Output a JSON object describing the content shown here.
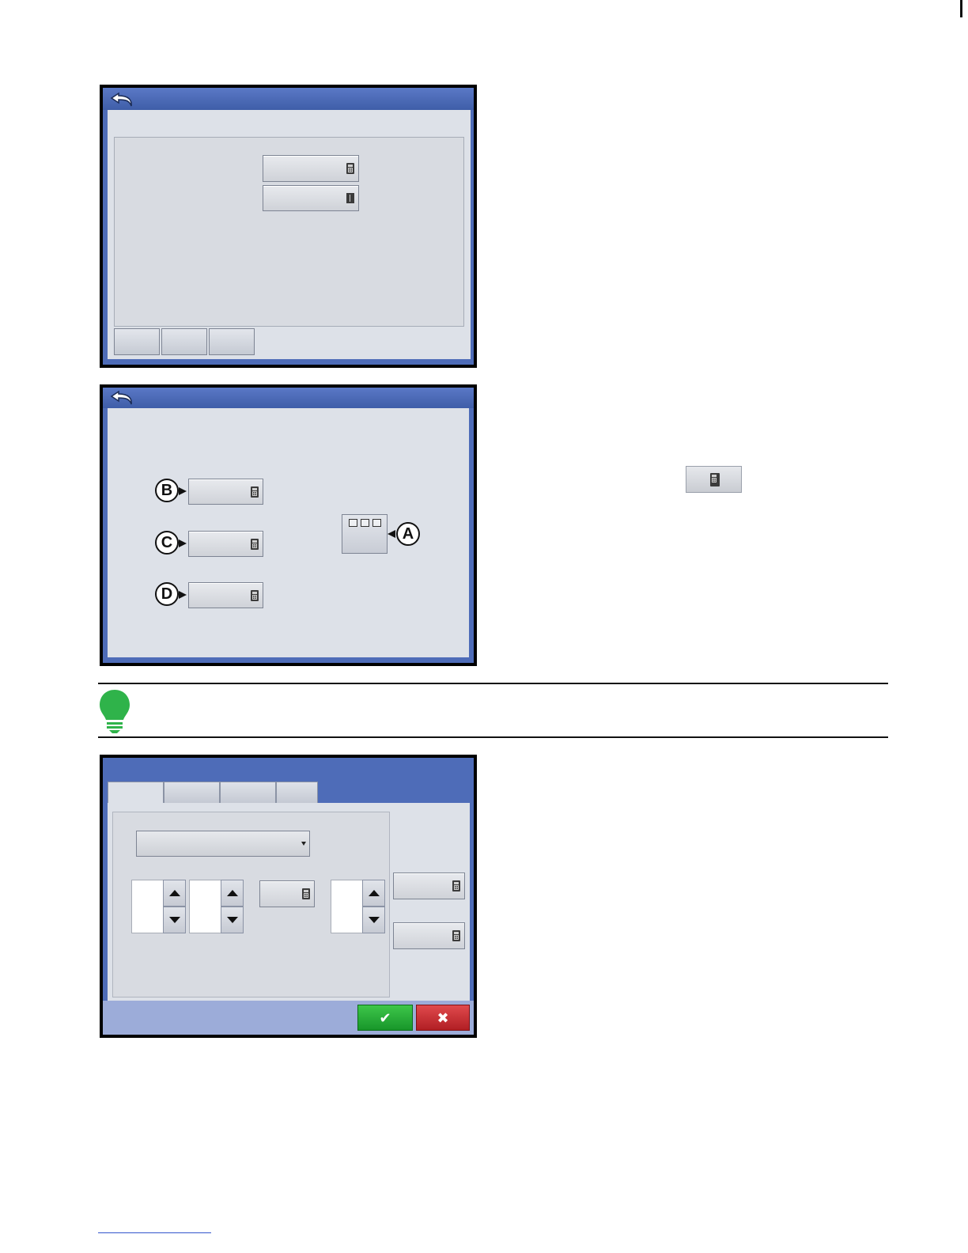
{
  "screen1": {
    "tabs": [
      "",
      "",
      ""
    ],
    "fields": [
      "",
      ""
    ],
    "bottom_buttons": [
      "",
      "",
      ""
    ],
    "icons": {
      "back": "back-arrow-icon",
      "field1": "calculator-icon",
      "field2": "grid-icon"
    }
  },
  "screen2": {
    "callouts": {
      "a": "A",
      "b": "B",
      "c": "C",
      "d": "D"
    },
    "fields": [
      "",
      "",
      ""
    ],
    "icons": {
      "back": "back-arrow-icon",
      "field": "calculator-icon",
      "widget": "three-box-widget"
    }
  },
  "inline_icon": {
    "name": "calculator-button-icon"
  },
  "note": {
    "icon": "lightbulb-icon",
    "accent": "#2fb34a"
  },
  "screen3": {
    "tabs": [
      "",
      "",
      "",
      ""
    ],
    "dropdown": {
      "value": ""
    },
    "spinners": [
      "",
      "",
      ""
    ],
    "calc_fields": [
      "",
      "",
      ""
    ],
    "buttons": {
      "ok": "✔",
      "cancel": "✖"
    },
    "colors": {
      "ok": "#22a832",
      "cancel": "#c8262b"
    }
  }
}
